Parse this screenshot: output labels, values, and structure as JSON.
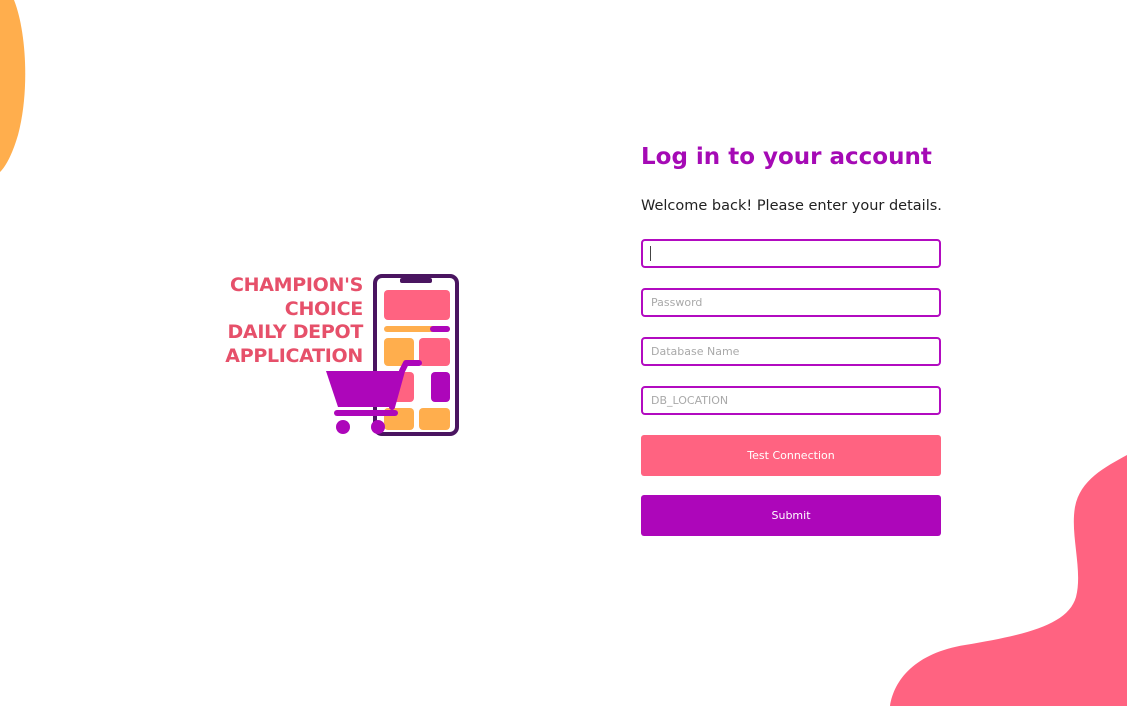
{
  "colors": {
    "accent_purple": "#ad06ba",
    "accent_pink": "#ff6381",
    "logo_text": "#e6506a",
    "blob_orange": "#ffae4d",
    "blob_pink": "#ff6381"
  },
  "logo": {
    "lines": [
      "CHAMPION'S",
      "CHOICE",
      "DAILY DEPOT",
      "APPLICATION"
    ],
    "graphic_icon": "shopping-cart-phone-icon"
  },
  "login": {
    "title": "Log in to your account",
    "subtitle": "Welcome back! Please enter your details.",
    "username": {
      "value": "",
      "placeholder": ""
    },
    "password": {
      "value": "",
      "placeholder": "Password"
    },
    "database": {
      "value": "",
      "placeholder": "Database Name"
    },
    "db_location": {
      "value": "",
      "placeholder": "DB_LOCATION"
    },
    "test_button": "Test Connection",
    "submit_button": "Submit"
  }
}
